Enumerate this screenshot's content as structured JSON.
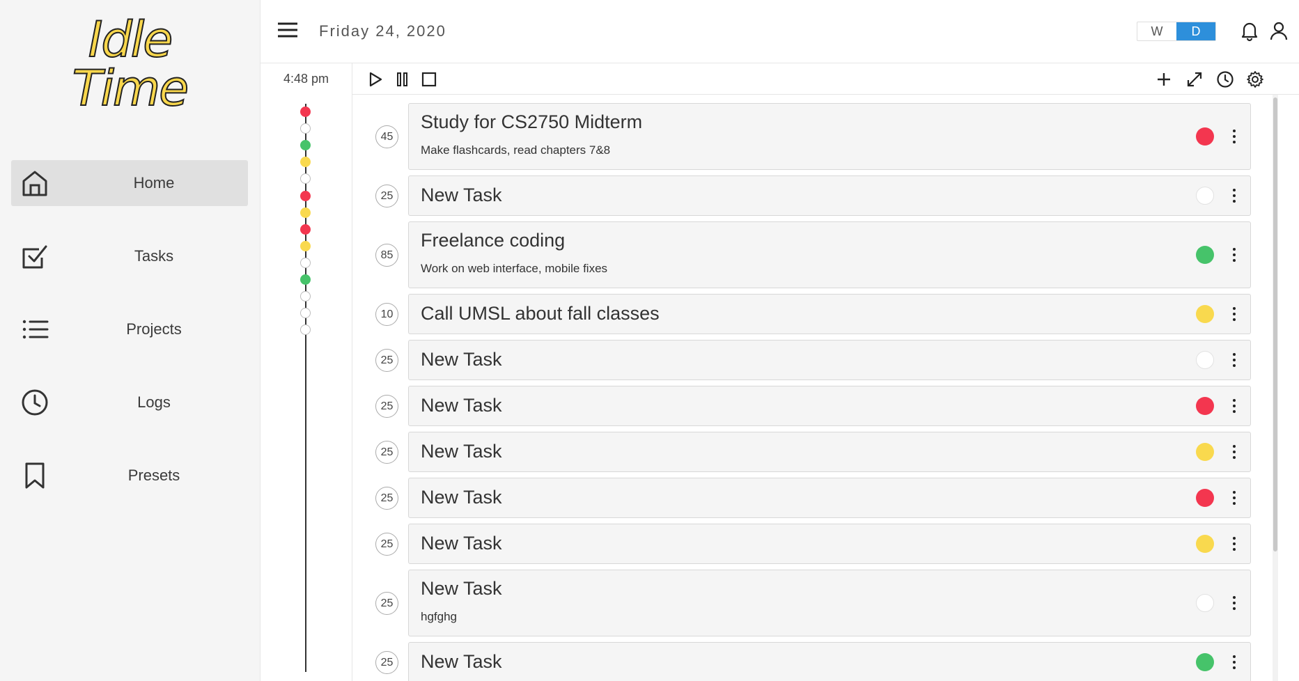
{
  "app": {
    "logo_line1": "Idle",
    "logo_line2": "Time"
  },
  "sidebar": {
    "items": [
      {
        "label": "Home",
        "icon": "home-icon",
        "active": true
      },
      {
        "label": "Tasks",
        "icon": "checkbox-icon",
        "active": false
      },
      {
        "label": "Projects",
        "icon": "list-icon",
        "active": false
      },
      {
        "label": "Logs",
        "icon": "clock-icon",
        "active": false
      },
      {
        "label": "Presets",
        "icon": "bookmark-icon",
        "active": false
      }
    ]
  },
  "header": {
    "date": "Friday 24, 2020",
    "view_week": "W",
    "view_day": "D",
    "active_view": "D"
  },
  "timeline": {
    "time": "4:48 pm",
    "dots": [
      "red",
      "white",
      "green",
      "yellow",
      "white",
      "red",
      "yellow",
      "red",
      "yellow",
      "white",
      "green",
      "white",
      "white",
      "white"
    ]
  },
  "colors": {
    "red": "#f3364f",
    "green": "#46c36a",
    "yellow": "#f9d94e",
    "white": "#ffffff",
    "accent": "#2d8fdb"
  },
  "tasks": [
    {
      "minutes": "45",
      "title": "Study for CS2750 Midterm",
      "subtitle": "Make flashcards, read chapters 7&8",
      "color": "red"
    },
    {
      "minutes": "25",
      "title": "New Task",
      "subtitle": "",
      "color": "white"
    },
    {
      "minutes": "85",
      "title": "Freelance coding",
      "subtitle": "Work on web interface, mobile fixes",
      "color": "green"
    },
    {
      "minutes": "10",
      "title": "Call UMSL about fall classes",
      "subtitle": "",
      "color": "yellow"
    },
    {
      "minutes": "25",
      "title": "New Task",
      "subtitle": "",
      "color": "white"
    },
    {
      "minutes": "25",
      "title": "New Task",
      "subtitle": "",
      "color": "red"
    },
    {
      "minutes": "25",
      "title": "New Task",
      "subtitle": "",
      "color": "yellow"
    },
    {
      "minutes": "25",
      "title": "New Task",
      "subtitle": "",
      "color": "red"
    },
    {
      "minutes": "25",
      "title": "New Task",
      "subtitle": "",
      "color": "yellow"
    },
    {
      "minutes": "25",
      "title": "New Task",
      "subtitle": "hgfghg",
      "color": "white"
    },
    {
      "minutes": "25",
      "title": "New Task",
      "subtitle": "",
      "color": "green"
    }
  ]
}
